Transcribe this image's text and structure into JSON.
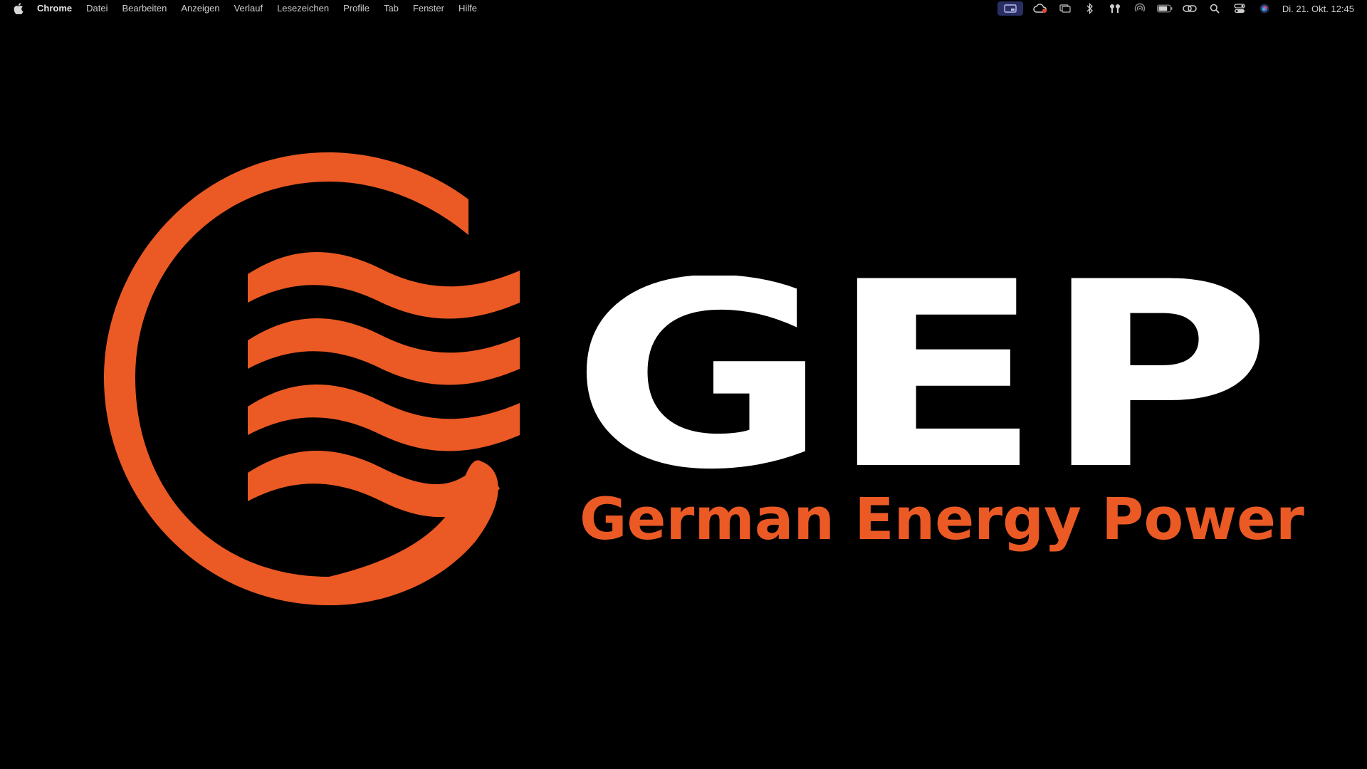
{
  "menubar": {
    "app_name": "Chrome",
    "menus": [
      "Datei",
      "Bearbeiten",
      "Anzeigen",
      "Verlauf",
      "Lesezeichen",
      "Profile",
      "Tab",
      "Fenster",
      "Hilfe"
    ],
    "status_icons": [
      "screen-share-icon",
      "creative-cloud-icon",
      "window-icon",
      "bluetooth-icon",
      "airpods-icon",
      "airplay-icon",
      "battery-icon",
      "link-icon",
      "search-icon",
      "control-center-icon",
      "siri-icon"
    ],
    "clock": "Di. 21. Okt.  12:45"
  },
  "logo": {
    "brand": "GEP",
    "tagline": "German Energy Power",
    "brand_color": "#eb5a24",
    "text_color": "#ffffff"
  }
}
